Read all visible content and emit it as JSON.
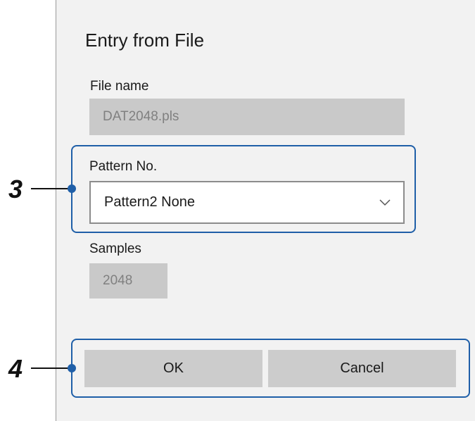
{
  "dialog": {
    "title": "Entry from File",
    "file_name": {
      "label": "File name",
      "value": "DAT2048.pls"
    },
    "pattern_no": {
      "label": "Pattern No.",
      "selected": "Pattern2  None"
    },
    "samples": {
      "label": "Samples",
      "value": "2048"
    },
    "ok_label": "OK",
    "cancel_label": "Cancel"
  },
  "callouts": {
    "pattern": "3",
    "buttons": "4"
  },
  "colors": {
    "highlight": "#1f5fa8",
    "dialog_bg": "#f2f2f2",
    "disabled_field": "#c9c9c9",
    "button_bg": "#cccccc"
  }
}
